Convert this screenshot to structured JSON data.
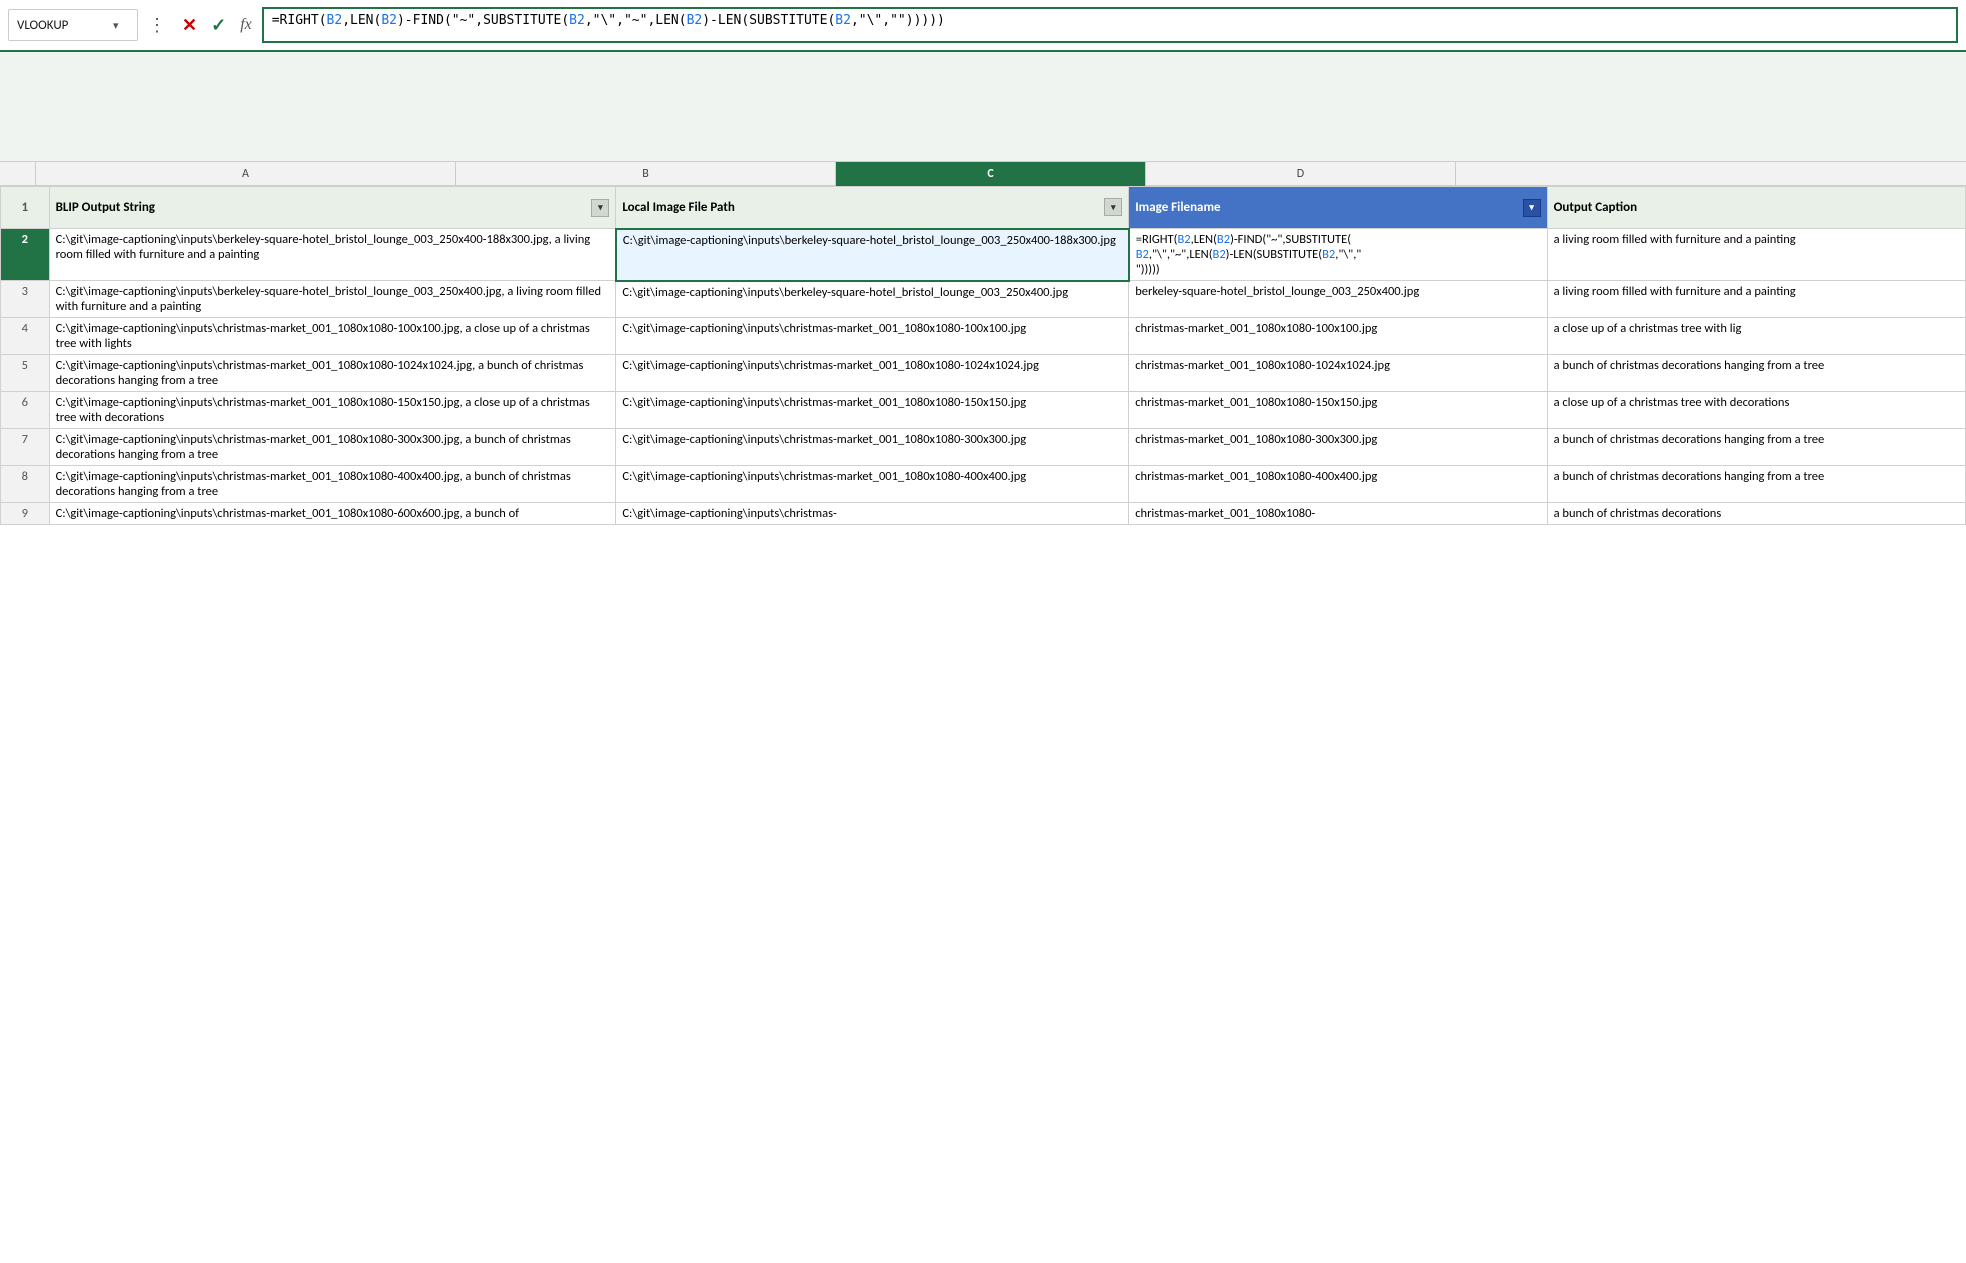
{
  "formula_bar": {
    "name_box": "VLOOKUP",
    "name_box_arrow": "▾",
    "dots": "⋮",
    "btn_cancel": "✕",
    "btn_confirm": "✓",
    "btn_fx": "fx",
    "formula": "=RIGHT(B2,LEN(B2)-FIND(\"~\",SUBSTITUTE(B2,\"\\\\\",\"~\",LEN(B2)-LEN(SUBSTITUTE(B2,\"\\\\\",\"\")))))"
  },
  "columns": {
    "letters": [
      "A",
      "B",
      "C",
      "D"
    ],
    "widths": [
      420,
      380,
      310,
      310
    ],
    "headers": [
      "BLIP Output String",
      "Local Image File Path",
      "Image Filename",
      "Output Caption"
    ]
  },
  "rows": [
    {
      "num": "2",
      "a": "C:\\git\\image-captioning\\inputs\\berkeley-square-hotel_bristol_lounge_003_250x400-188x300.jpg, a living room filled with furniture and a painting",
      "b": "C:\\git\\image-captioning\\inputs\\berkeley-square-hotel_bristol_lounge_003_250x400-188x300.jpg",
      "c_formula": "=RIGHT(B2,LEN(B2)-FIND(\"~\",SUBSTITUTE(B2,\"\\\",\"~\",LEN(B2)-LEN(SUBSTITUTE(B2,\"\\\",\"\")))))",
      "c_formula_display": "=RIGHT(B2,LEN(B2)-FIND(\"~\",SUBSTITUTE(\nB2,\"\\\",\"~\",LEN(B2)-LEN(SUBSTITUTE(B2,\"\\\",\"\n\")))))",
      "d": "a living room filled with furniture and a painting"
    },
    {
      "num": "3",
      "a": "C:\\git\\image-captioning\\inputs\\berkeley-square-hotel_bristol_lounge_003_250x400.jpg, a living room filled with furniture and a painting",
      "b": "C:\\git\\image-captioning\\inputs\\berkeley-square-hotel_bristol_lounge_003_250x400.jpg",
      "c": "berkeley-square-hotel_bristol_lounge_003_250x400.jpg",
      "d": "a living room filled with furniture and a painting"
    },
    {
      "num": "4",
      "a": "C:\\git\\image-captioning\\inputs\\christmas-market_001_1080x1080-100x100.jpg, a close up of a christmas tree with lights",
      "b": "C:\\git\\image-captioning\\inputs\\christmas-market_001_1080x1080-100x100.jpg",
      "c": "christmas-market_001_1080x1080-100x100.jpg",
      "d": "a close up of a christmas tree with lig"
    },
    {
      "num": "5",
      "a": "C:\\git\\image-captioning\\inputs\\christmas-market_001_1080x1080-1024x1024.jpg, a bunch of christmas decorations hanging from a tree",
      "b": "C:\\git\\image-captioning\\inputs\\christmas-market_001_1080x1080-1024x1024.jpg",
      "c": "christmas-market_001_1080x1080-1024x1024.jpg",
      "d": "a bunch of christmas decorations hanging from a tree"
    },
    {
      "num": "6",
      "a": "C:\\git\\image-captioning\\inputs\\christmas-market_001_1080x1080-150x150.jpg, a close up of a christmas tree with decorations",
      "b": "C:\\git\\image-captioning\\inputs\\christmas-market_001_1080x1080-150x150.jpg",
      "c": "christmas-market_001_1080x1080-150x150.jpg",
      "d": "a close up of a christmas tree with decorations"
    },
    {
      "num": "7",
      "a": "C:\\git\\image-captioning\\inputs\\christmas-market_001_1080x1080-300x300.jpg, a bunch of christmas decorations hanging from a tree",
      "b": "C:\\git\\image-captioning\\inputs\\christmas-market_001_1080x1080-300x300.jpg",
      "c": "christmas-market_001_1080x1080-300x300.jpg",
      "d": "a bunch of christmas decorations hanging from a tree"
    },
    {
      "num": "8",
      "a": "C:\\git\\image-captioning\\inputs\\christmas-market_001_1080x1080-400x400.jpg, a bunch of christmas decorations hanging from a tree",
      "b": "C:\\git\\image-captioning\\inputs\\christmas-market_001_1080x1080-400x400.jpg",
      "c": "christmas-market_001_1080x1080-400x400.jpg",
      "d": "a bunch of christmas decorations hanging from a tree"
    },
    {
      "num": "9",
      "a": "C:\\git\\image-captioning\\inputs\\christmas-market_001_1080x1080-600x600.jpg, a bunch of",
      "b": "C:\\git\\image-captioning\\inputs\\christmas-",
      "c": "christmas-market_001_1080x1080-",
      "d": "a bunch of christmas decorations"
    }
  ]
}
